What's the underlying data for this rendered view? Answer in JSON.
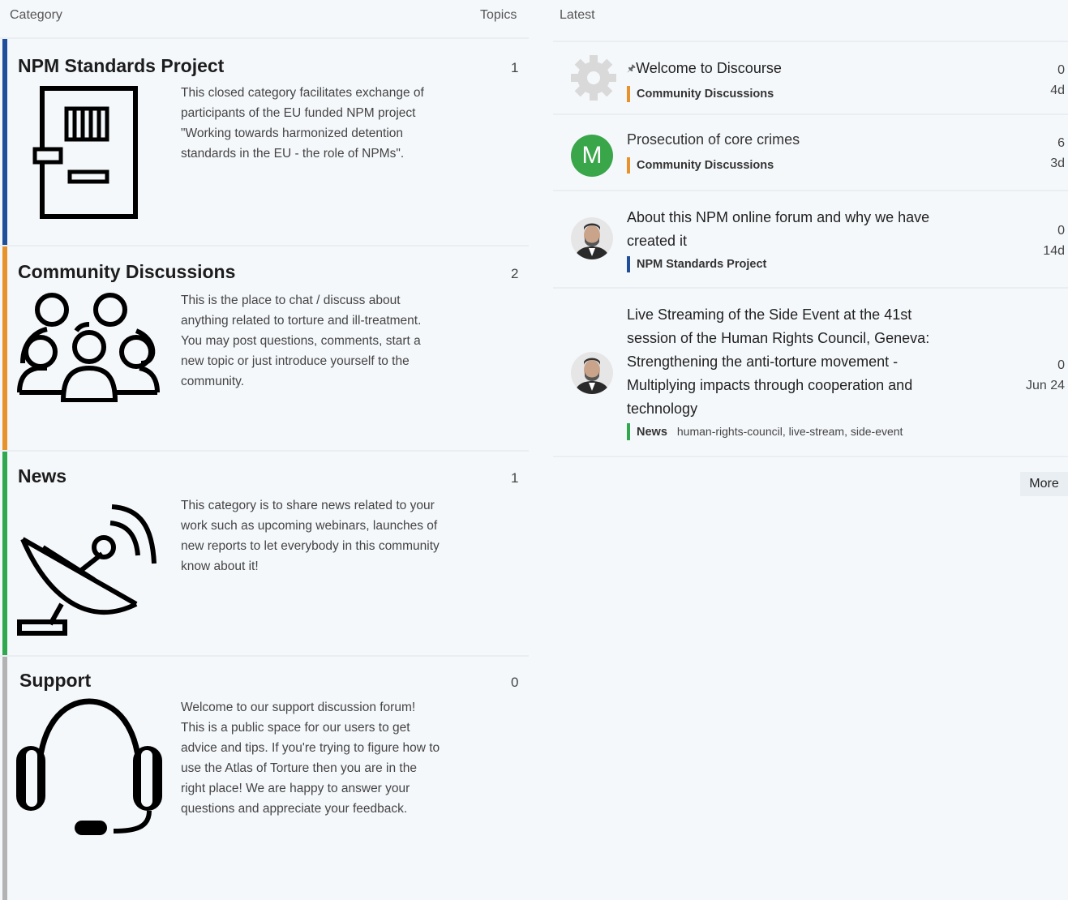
{
  "headers": {
    "category": "Category",
    "topics": "Topics",
    "latest": "Latest"
  },
  "categories": [
    {
      "title": "NPM Standards Project",
      "count": "1",
      "description": "This closed category facilitates exchange of participants of the EU funded NPM project \"Working towards harmonized detention standards in the EU - the role of NPMs\".",
      "color": "#1f4e9b",
      "icon": "prison-door-icon"
    },
    {
      "title": "Community Discussions",
      "count": "2",
      "description": "This is the place to chat / discuss about anything related to torture and ill-treatment. You may post questions, comments, start a new topic or just introduce yourself to the community.",
      "color": "#e8922b",
      "icon": "people-group-icon"
    },
    {
      "title": "News",
      "count": "1",
      "description": "This category is to share news related to your work such as upcoming webinars, launches of new reports to let everybody in this community know about it!",
      "color": "#2fa84f",
      "icon": "satellite-dish-icon"
    },
    {
      "title": "Support",
      "count": "0",
      "description": "Welcome to our support discussion forum! This is a public space for our users to get advice and tips. If you're trying to figure how to use the Atlas of Torture then you are in the right place! We are happy to answer your questions and appreciate your feedback.",
      "color": "#b3b3b3",
      "icon": "headset-icon"
    }
  ],
  "latest": [
    {
      "title": "Welcome to Discourse",
      "pinned": true,
      "category": "Community Discussions",
      "category_color": "#e8922b",
      "tags": "",
      "replies": "0",
      "age": "4d",
      "avatar": "gear-avatar"
    },
    {
      "title": "Prosecution of core crimes",
      "pinned": false,
      "category": "Community Discussions",
      "category_color": "#e8922b",
      "tags": "",
      "replies": "6",
      "age": "3d",
      "avatar": "letter-avatar",
      "avatar_letter": "M",
      "avatar_color": "#3aa64a"
    },
    {
      "title": "About this NPM online forum and why we have created it",
      "pinned": false,
      "category": "NPM Standards Project",
      "category_color": "#1f4e9b",
      "tags": "",
      "replies": "0",
      "age": "14d",
      "avatar": "photo-avatar"
    },
    {
      "title": "Live Streaming of the Side Event at the 41st session of the Human Rights Council, Geneva: Strengthening the anti-torture movement - Multiplying impacts through cooperation and technology",
      "pinned": false,
      "category": "News",
      "category_color": "#2fa84f",
      "tags": "human-rights-council, live-stream, side-event",
      "replies": "0",
      "age": "Jun 24",
      "avatar": "photo-avatar"
    }
  ],
  "more_label": "More",
  "pin_glyph": "🖈"
}
